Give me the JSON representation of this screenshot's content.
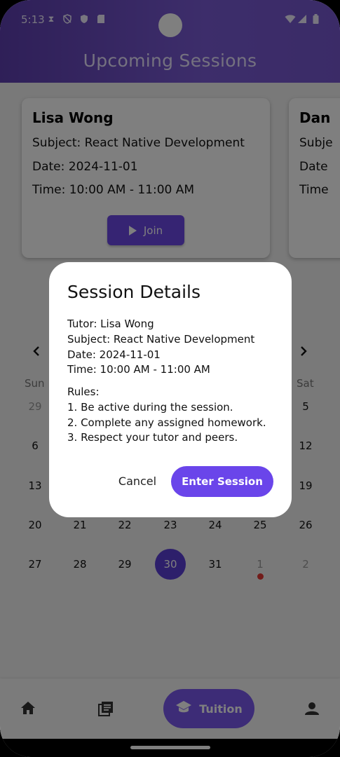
{
  "status_bar": {
    "time": "5:13"
  },
  "header": {
    "title": "Upcoming Sessions"
  },
  "sessions": [
    {
      "tutor": "Lisa Wong",
      "subject": "Subject: React Native Development",
      "date": "Date: 2024-11-01",
      "time": "Time: 10:00 AM - 11:00 AM",
      "join_label": "Join"
    },
    {
      "tutor": "Dan",
      "subject": "Subje",
      "date": "Date",
      "time": "Time"
    }
  ],
  "calendar": {
    "weekday_first": "Sun",
    "weekday_last": "Sat",
    "rows": [
      {
        "sun": "29",
        "sat": "5"
      },
      {
        "sun": "6",
        "sat": "12"
      },
      {
        "sun": "13",
        "sat": "19"
      },
      {
        "days": [
          "20",
          "21",
          "22",
          "23",
          "24",
          "25",
          "26"
        ]
      },
      {
        "days": [
          "27",
          "28",
          "29",
          "30",
          "31",
          "1",
          "2"
        ]
      }
    ],
    "selected_day": "30",
    "event_marker_day": "1"
  },
  "dialog": {
    "title": "Session Details",
    "tutor": "Tutor: Lisa Wong",
    "subject": "Subject: React Native Development",
    "date": "Date: 2024-11-01",
    "time": "Time: 10:00 AM - 11:00 AM",
    "rules_heading": "Rules:",
    "rules": [
      "1. Be active during the session.",
      "2. Complete any assigned homework.",
      "3. Respect your tutor and peers."
    ],
    "cancel_label": "Cancel",
    "enter_label": "Enter Session"
  },
  "bottom_nav": {
    "items": [
      {
        "icon": "home-icon"
      },
      {
        "icon": "library-books-icon"
      },
      {
        "icon": "school-icon",
        "label": "Tuition",
        "active": true
      },
      {
        "icon": "person-icon"
      }
    ]
  },
  "colors": {
    "header_gradient_start": "#5e3fb0",
    "accent": "#6a45ea",
    "event_dot": "#e53935"
  }
}
